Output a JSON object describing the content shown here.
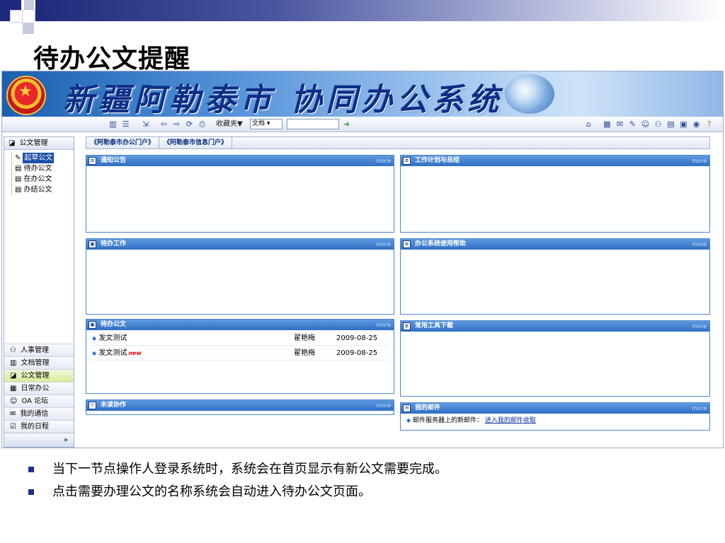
{
  "slide": {
    "title": "待办公文提醒",
    "bullets": [
      "当下一节点操作人登录系统时，系统会在首页显示有新公文需要完成。",
      "点击需要办理公文的名称系统会自动进入待办公文页面。"
    ]
  },
  "app": {
    "banner_title": "新疆阿勒泰市 协同办公系统",
    "toolbar": {
      "favorites_label": "收藏夹▼",
      "search_type": "文档 ▾",
      "search_value": ""
    },
    "sidebar": {
      "header": "公文管理",
      "tree": [
        "起草公文",
        "待办公文",
        "在办公文",
        "办结公文"
      ],
      "menu": [
        "人事管理",
        "文档管理",
        "公文管理",
        "日常办公",
        "OA 论坛",
        "我的通信",
        "我的日程"
      ],
      "expand": "»"
    },
    "portal_tabs": [
      "《阿勒泰市办公门户》",
      "《阿勒泰市信息门户》"
    ],
    "panels": {
      "notice": "通知公告",
      "workplan": "工作计划与总结",
      "todo_work": "待办工作",
      "help": "办公系统使用帮助",
      "todo_docs": "待办公文",
      "tools": "常用工具下载",
      "unread": "未读协作",
      "mail": "我的邮件",
      "more": "more"
    },
    "todo_docs_rows": [
      {
        "title": "发文测试",
        "author": "翟艳梅",
        "date": "2009-08-25",
        "is_new": false
      },
      {
        "title": "发文测试",
        "author": "翟艳梅",
        "date": "2009-08-25",
        "is_new": true,
        "badge": "new"
      }
    ],
    "mail": {
      "label": "邮件服务器上的新邮件：",
      "link": "进入我的邮件收取"
    }
  }
}
